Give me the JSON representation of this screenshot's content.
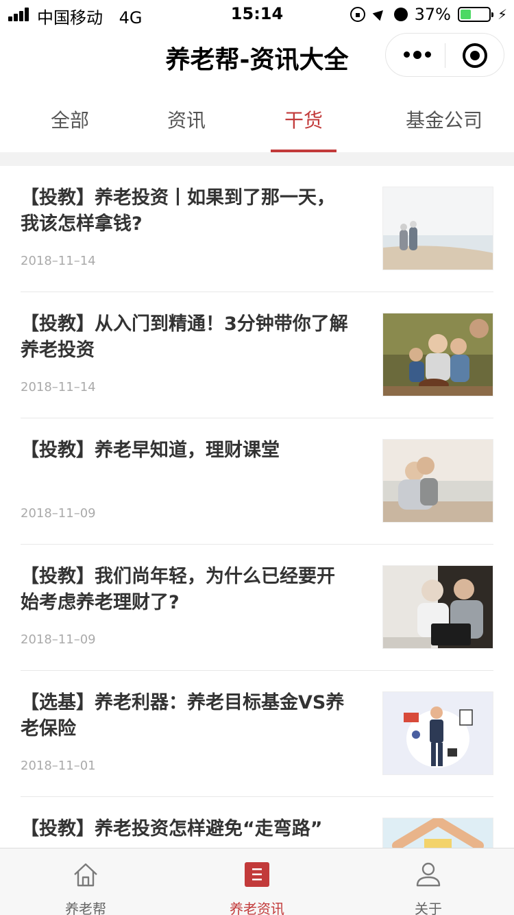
{
  "status_bar": {
    "carrier": "中国移动",
    "network": "4G",
    "time": "15:14",
    "battery_text": "37%",
    "battery_level": 0.37,
    "battery_color": "#4cd964"
  },
  "nav": {
    "title": "养老帮-资讯大全",
    "more_icon": "more-dots-icon",
    "close_icon": "target-icon"
  },
  "tabs": [
    {
      "label": "全部",
      "active": false
    },
    {
      "label": "资讯",
      "active": false
    },
    {
      "label": "干货",
      "active": true
    },
    {
      "label": "基金公司",
      "active": false
    }
  ],
  "articles": [
    {
      "title": "【投教】养老投资丨如果到了那一天，我该怎样拿钱?",
      "date": "2018–11–14",
      "image": "elderly-couple-beach-photo"
    },
    {
      "title": "【投教】从入门到精通！3分钟带你了解养老投资",
      "date": "2018–11–14",
      "image": "family-birthday-cake-photo"
    },
    {
      "title": "【投教】养老早知道，理财课堂",
      "date": "2018–11–09",
      "image": "couple-piggyback-beach-photo"
    },
    {
      "title": "【投教】我们尚年轻，为什么已经要开始考虑养老理财了?",
      "date": "2018–11–09",
      "image": "elderly-couple-tablet-photo"
    },
    {
      "title": "【选基】养老利器：养老目标基金VS养老保险",
      "date": "2018–11–01",
      "image": "multitasking-businessman-illustration"
    },
    {
      "title": "【投教】养老投资怎样避免“走弯路”",
      "date": "",
      "image": "hands-roof-illustration"
    }
  ],
  "tabbar": [
    {
      "label": "养老帮",
      "icon": "home-icon",
      "active": false
    },
    {
      "label": "养老资讯",
      "icon": "news-icon",
      "active": true
    },
    {
      "label": "关于",
      "icon": "user-icon",
      "active": false
    }
  ],
  "colors": {
    "accent": "#c23a3a"
  }
}
